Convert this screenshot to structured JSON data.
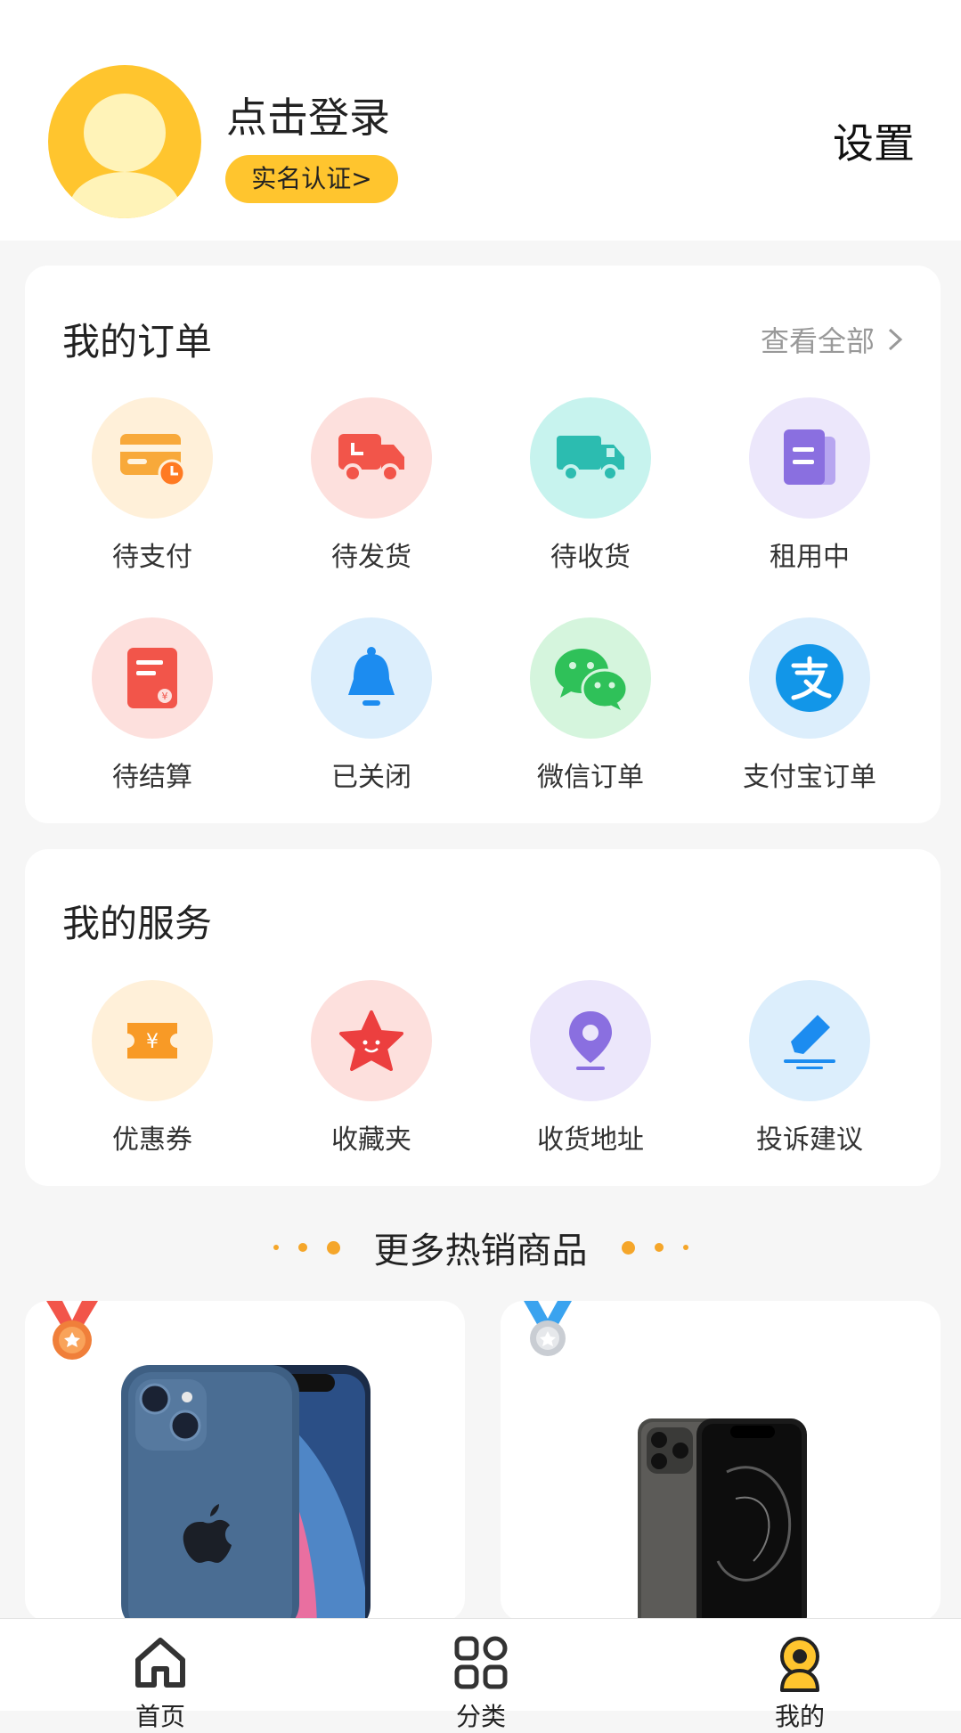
{
  "header": {
    "login_text": "点击登录",
    "realname_label": "实名认证>",
    "settings_label": "设置"
  },
  "orders": {
    "title": "我的订单",
    "view_all": "查看全部",
    "items": [
      {
        "label": "待支付",
        "icon": "card-clock-icon",
        "bg": "#fff0d9"
      },
      {
        "label": "待发货",
        "icon": "delivery-truck-icon",
        "bg": "#fde0dd"
      },
      {
        "label": "待收货",
        "icon": "truck-icon",
        "bg": "#c7f3ee"
      },
      {
        "label": "租用中",
        "icon": "document-icon",
        "bg": "#ece7fb"
      },
      {
        "label": "待结算",
        "icon": "bill-icon",
        "bg": "#fde0dd"
      },
      {
        "label": "已关闭",
        "icon": "bell-icon",
        "bg": "#dceefc"
      },
      {
        "label": "微信订单",
        "icon": "wechat-icon",
        "bg": "#d5f5dd"
      },
      {
        "label": "支付宝订单",
        "icon": "alipay-icon",
        "bg": "#dceefc"
      }
    ]
  },
  "services": {
    "title": "我的服务",
    "items": [
      {
        "label": "优惠券",
        "icon": "coupon-icon",
        "bg": "#fff0d9"
      },
      {
        "label": "收藏夹",
        "icon": "star-icon",
        "bg": "#fde0dd"
      },
      {
        "label": "收货地址",
        "icon": "location-pin-icon",
        "bg": "#ece7fb"
      },
      {
        "label": "投诉建议",
        "icon": "edit-pen-icon",
        "bg": "#dceefc"
      }
    ]
  },
  "hot": {
    "title": "更多热销商品"
  },
  "products": [
    {
      "medal": "bronze-medal-icon",
      "image": "blue-iphone-image"
    },
    {
      "medal": "silver-medal-icon",
      "image": "graphite-iphone-image"
    }
  ],
  "tabbar": {
    "items": [
      {
        "label": "首页",
        "icon": "home-icon"
      },
      {
        "label": "分类",
        "icon": "category-grid-icon"
      },
      {
        "label": "我的",
        "icon": "profile-icon"
      }
    ]
  },
  "colors": {
    "accent": "#ffc52e",
    "background": "#f6f6f6",
    "dot": "#f5a62a"
  }
}
